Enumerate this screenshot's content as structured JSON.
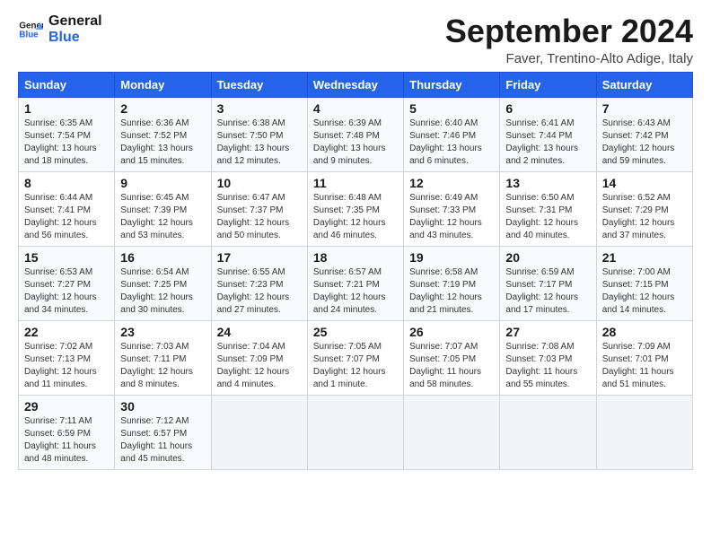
{
  "header": {
    "logo_line1": "General",
    "logo_line2": "Blue",
    "title": "September 2024",
    "location": "Faver, Trentino-Alto Adige, Italy"
  },
  "calendar": {
    "days_of_week": [
      "Sunday",
      "Monday",
      "Tuesday",
      "Wednesday",
      "Thursday",
      "Friday",
      "Saturday"
    ],
    "weeks": [
      [
        {
          "day": "1",
          "info": "Sunrise: 6:35 AM\nSunset: 7:54 PM\nDaylight: 13 hours and 18 minutes."
        },
        {
          "day": "2",
          "info": "Sunrise: 6:36 AM\nSunset: 7:52 PM\nDaylight: 13 hours and 15 minutes."
        },
        {
          "day": "3",
          "info": "Sunrise: 6:38 AM\nSunset: 7:50 PM\nDaylight: 13 hours and 12 minutes."
        },
        {
          "day": "4",
          "info": "Sunrise: 6:39 AM\nSunset: 7:48 PM\nDaylight: 13 hours and 9 minutes."
        },
        {
          "day": "5",
          "info": "Sunrise: 6:40 AM\nSunset: 7:46 PM\nDaylight: 13 hours and 6 minutes."
        },
        {
          "day": "6",
          "info": "Sunrise: 6:41 AM\nSunset: 7:44 PM\nDaylight: 13 hours and 2 minutes."
        },
        {
          "day": "7",
          "info": "Sunrise: 6:43 AM\nSunset: 7:42 PM\nDaylight: 12 hours and 59 minutes."
        }
      ],
      [
        {
          "day": "8",
          "info": "Sunrise: 6:44 AM\nSunset: 7:41 PM\nDaylight: 12 hours and 56 minutes."
        },
        {
          "day": "9",
          "info": "Sunrise: 6:45 AM\nSunset: 7:39 PM\nDaylight: 12 hours and 53 minutes."
        },
        {
          "day": "10",
          "info": "Sunrise: 6:47 AM\nSunset: 7:37 PM\nDaylight: 12 hours and 50 minutes."
        },
        {
          "day": "11",
          "info": "Sunrise: 6:48 AM\nSunset: 7:35 PM\nDaylight: 12 hours and 46 minutes."
        },
        {
          "day": "12",
          "info": "Sunrise: 6:49 AM\nSunset: 7:33 PM\nDaylight: 12 hours and 43 minutes."
        },
        {
          "day": "13",
          "info": "Sunrise: 6:50 AM\nSunset: 7:31 PM\nDaylight: 12 hours and 40 minutes."
        },
        {
          "day": "14",
          "info": "Sunrise: 6:52 AM\nSunset: 7:29 PM\nDaylight: 12 hours and 37 minutes."
        }
      ],
      [
        {
          "day": "15",
          "info": "Sunrise: 6:53 AM\nSunset: 7:27 PM\nDaylight: 12 hours and 34 minutes."
        },
        {
          "day": "16",
          "info": "Sunrise: 6:54 AM\nSunset: 7:25 PM\nDaylight: 12 hours and 30 minutes."
        },
        {
          "day": "17",
          "info": "Sunrise: 6:55 AM\nSunset: 7:23 PM\nDaylight: 12 hours and 27 minutes."
        },
        {
          "day": "18",
          "info": "Sunrise: 6:57 AM\nSunset: 7:21 PM\nDaylight: 12 hours and 24 minutes."
        },
        {
          "day": "19",
          "info": "Sunrise: 6:58 AM\nSunset: 7:19 PM\nDaylight: 12 hours and 21 minutes."
        },
        {
          "day": "20",
          "info": "Sunrise: 6:59 AM\nSunset: 7:17 PM\nDaylight: 12 hours and 17 minutes."
        },
        {
          "day": "21",
          "info": "Sunrise: 7:00 AM\nSunset: 7:15 PM\nDaylight: 12 hours and 14 minutes."
        }
      ],
      [
        {
          "day": "22",
          "info": "Sunrise: 7:02 AM\nSunset: 7:13 PM\nDaylight: 12 hours and 11 minutes."
        },
        {
          "day": "23",
          "info": "Sunrise: 7:03 AM\nSunset: 7:11 PM\nDaylight: 12 hours and 8 minutes."
        },
        {
          "day": "24",
          "info": "Sunrise: 7:04 AM\nSunset: 7:09 PM\nDaylight: 12 hours and 4 minutes."
        },
        {
          "day": "25",
          "info": "Sunrise: 7:05 AM\nSunset: 7:07 PM\nDaylight: 12 hours and 1 minute."
        },
        {
          "day": "26",
          "info": "Sunrise: 7:07 AM\nSunset: 7:05 PM\nDaylight: 11 hours and 58 minutes."
        },
        {
          "day": "27",
          "info": "Sunrise: 7:08 AM\nSunset: 7:03 PM\nDaylight: 11 hours and 55 minutes."
        },
        {
          "day": "28",
          "info": "Sunrise: 7:09 AM\nSunset: 7:01 PM\nDaylight: 11 hours and 51 minutes."
        }
      ],
      [
        {
          "day": "29",
          "info": "Sunrise: 7:11 AM\nSunset: 6:59 PM\nDaylight: 11 hours and 48 minutes."
        },
        {
          "day": "30",
          "info": "Sunrise: 7:12 AM\nSunset: 6:57 PM\nDaylight: 11 hours and 45 minutes."
        },
        {
          "day": "",
          "info": ""
        },
        {
          "day": "",
          "info": ""
        },
        {
          "day": "",
          "info": ""
        },
        {
          "day": "",
          "info": ""
        },
        {
          "day": "",
          "info": ""
        }
      ]
    ]
  }
}
